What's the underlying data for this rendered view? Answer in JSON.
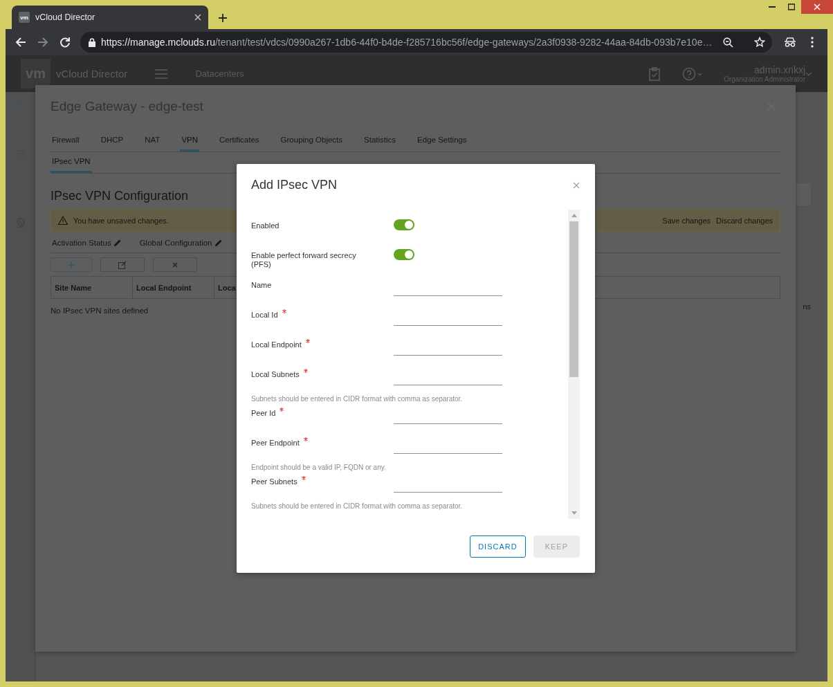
{
  "browser": {
    "favicon_text": "vm",
    "tab_title": "vCloud Director",
    "url_host": "https://manage.mclouds.ru",
    "url_path": "/tenant/test/vdcs/0990a267-1db6-44f0-b4de-f285716bc56f/edge-gateways/2a3f0938-9282-44aa-84db-093b7e10e…"
  },
  "header": {
    "logo": "vm",
    "app_name": "vCloud Director",
    "nav_link": "Datacenters",
    "user_name": "admin.xnkxj",
    "user_role": "Organization Administrator"
  },
  "background": {
    "fragment_text": "ns"
  },
  "edge_modal": {
    "title": "Edge Gateway - edge-test",
    "tabs": [
      {
        "label": "Firewall",
        "selected": false
      },
      {
        "label": "DHCP",
        "selected": false
      },
      {
        "label": "NAT",
        "selected": false
      },
      {
        "label": "VPN",
        "selected": true
      },
      {
        "label": "Certificates",
        "selected": false
      },
      {
        "label": "Grouping Objects",
        "selected": false
      },
      {
        "label": "Statistics",
        "selected": false
      },
      {
        "label": "Edge Settings",
        "selected": false
      }
    ],
    "subtabs": [
      {
        "label": "IPsec VPN",
        "selected": true
      }
    ],
    "heading": "IPsec VPN Configuration",
    "alert": {
      "message": "You have unsaved changes.",
      "actions": [
        "Save changes",
        "Discard changes"
      ]
    },
    "settings_links": [
      "Activation Status",
      "Global Configuration"
    ],
    "table_buttons": [
      {
        "kind": "add",
        "disabled": false
      },
      {
        "kind": "edit",
        "disabled": true
      },
      {
        "kind": "delete",
        "disabled": true
      }
    ],
    "table": {
      "columns": [
        "Site Name",
        "Local Endpoint",
        "Loca"
      ],
      "empty_text": "No IPsec VPN sites defined"
    }
  },
  "dialog": {
    "title": "Add IPsec VPN",
    "fields": [
      {
        "label": "Enabled",
        "kind": "toggle",
        "required": false,
        "on": true
      },
      {
        "label": "Enable perfect forward secrecy (PFS)",
        "kind": "toggle",
        "required": false,
        "on": true
      },
      {
        "label": "Name",
        "kind": "text",
        "required": false
      },
      {
        "label": "Local Id",
        "kind": "text",
        "required": true
      },
      {
        "label": "Local Endpoint",
        "kind": "text",
        "required": true
      },
      {
        "label": "Local Subnets",
        "kind": "text",
        "required": true,
        "hint": "Subnets should be entered in CIDR format with comma as separator."
      },
      {
        "label": "Peer Id",
        "kind": "text",
        "required": true
      },
      {
        "label": "Peer Endpoint",
        "kind": "text",
        "required": true,
        "hint": "Endpoint should be a valid IP, FQDN or any."
      },
      {
        "label": "Peer Subnets",
        "kind": "text",
        "required": true,
        "hint": "Subnets should be entered in CIDR format with comma as separator."
      }
    ],
    "buttons": [
      {
        "label": "DISCARD",
        "kind": "secondary",
        "disabled": false
      },
      {
        "label": "KEEP",
        "kind": "primary",
        "disabled": true
      }
    ]
  }
}
